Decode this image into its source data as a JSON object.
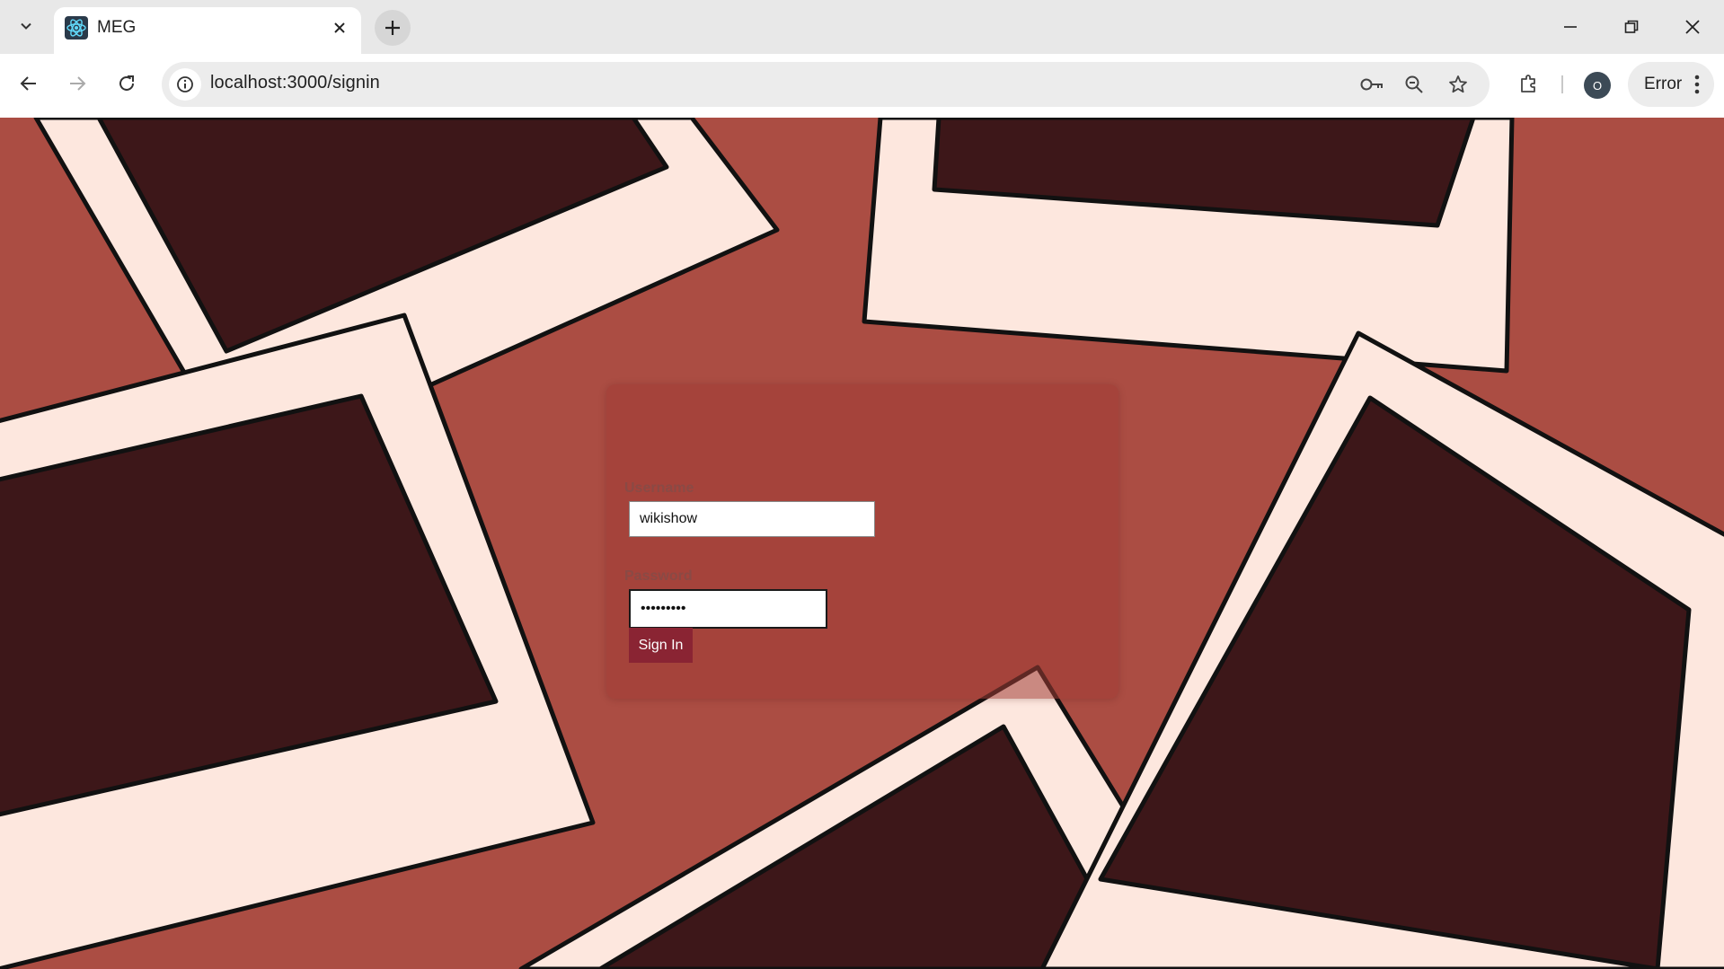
{
  "browser": {
    "tab": {
      "title": "MEG",
      "favicon": "react-atom-icon"
    },
    "address": {
      "url": "localhost:3000/signin"
    },
    "profile_initial": "O",
    "error_chip": "Error"
  },
  "signin": {
    "username_label": "Username",
    "username_value": "wikishow",
    "password_label": "Password",
    "password_value": "•••••••••",
    "submit_label": "Sign In"
  },
  "colors": {
    "background": "#ab4d43",
    "frame": "#fde7de",
    "photo": "#3d1719",
    "button": "#8a2433"
  }
}
